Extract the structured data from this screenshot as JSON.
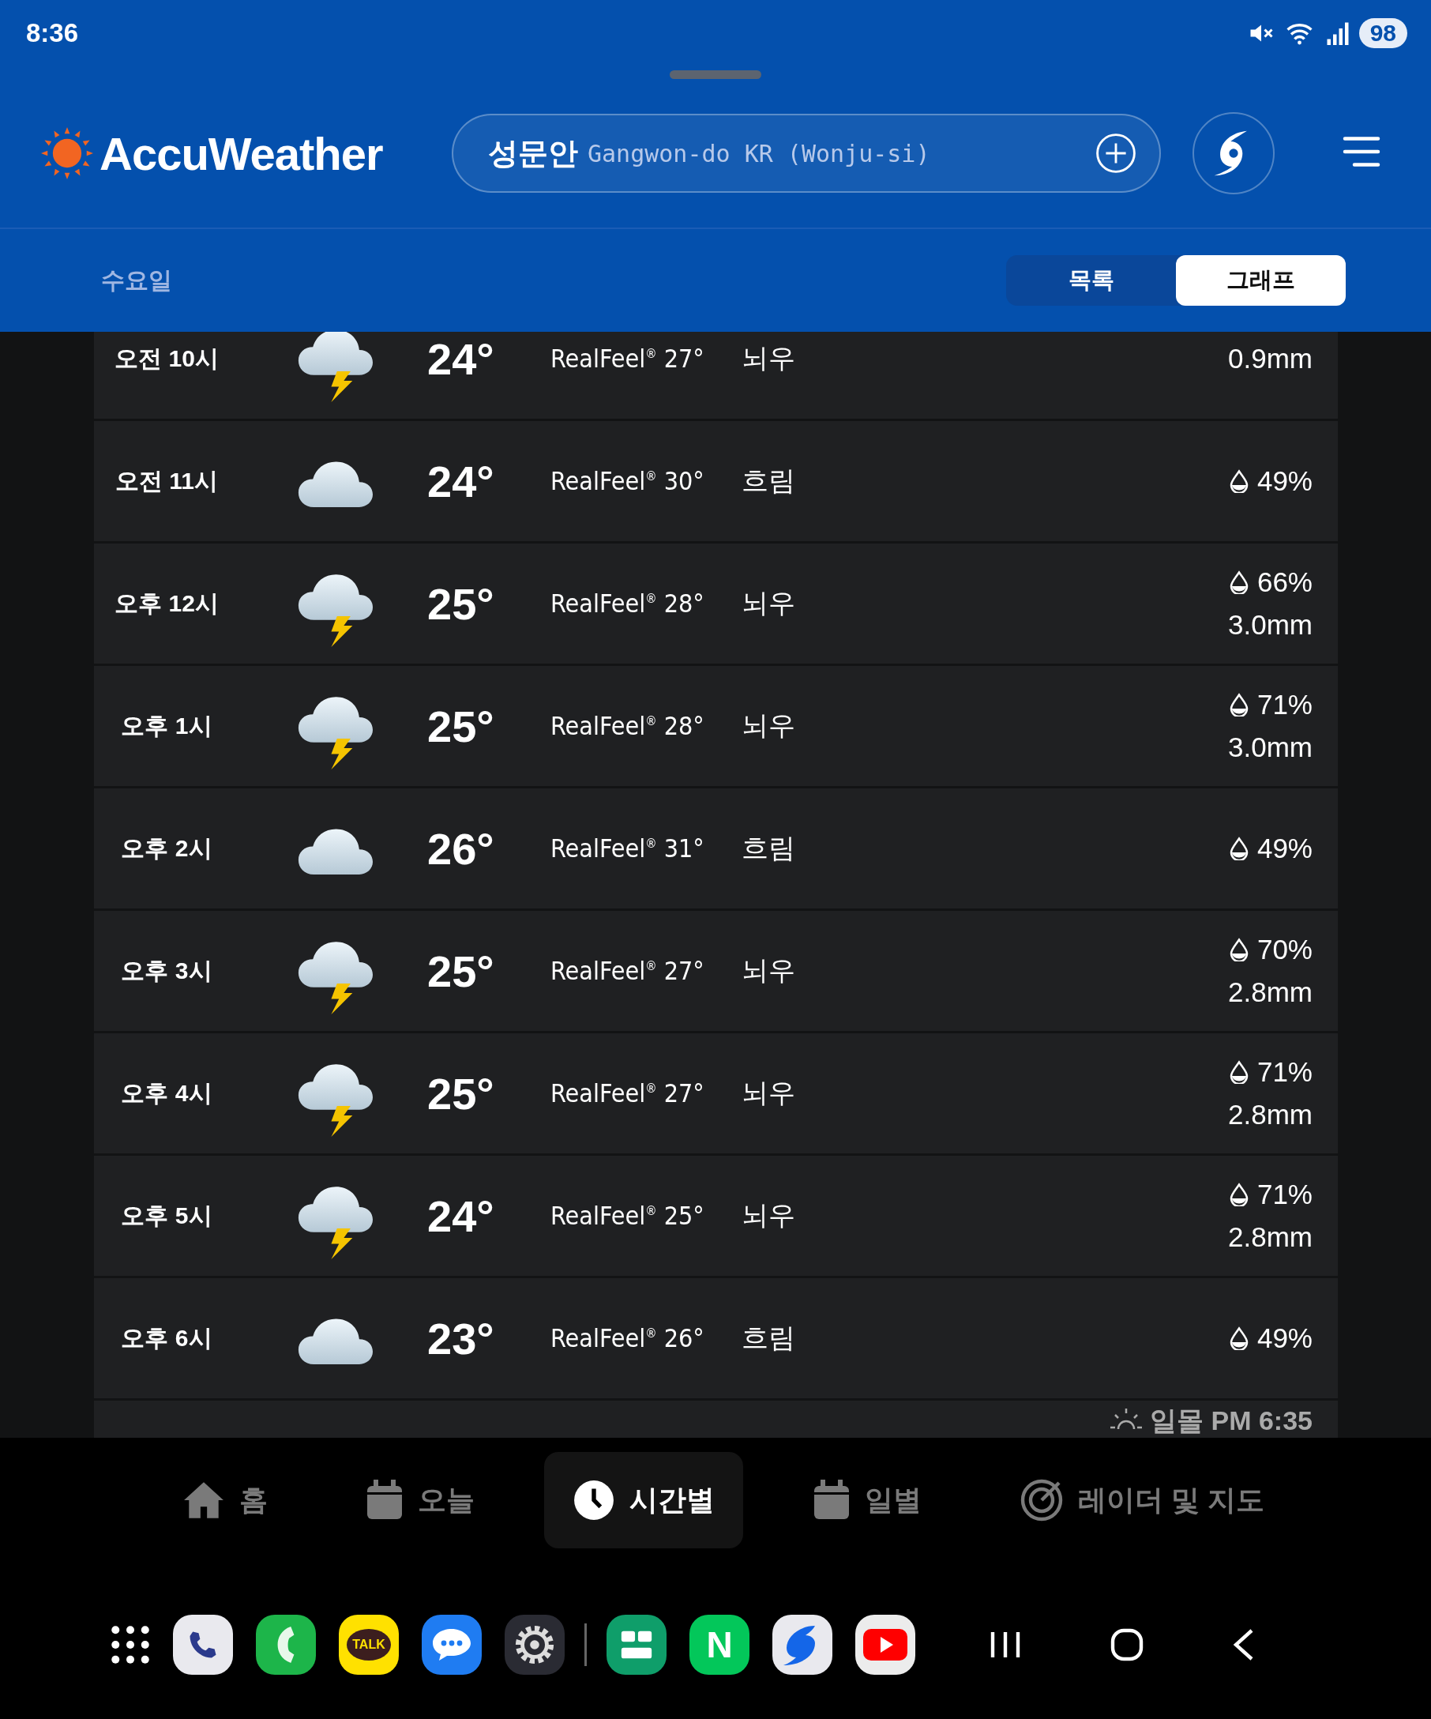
{
  "status_bar": {
    "time": "8:36",
    "battery": "98"
  },
  "header": {
    "brand": "AccuWeather",
    "location": {
      "name": "성문안",
      "detail": "Gangwon-do KR (Wonju-si)"
    }
  },
  "subheader": {
    "day": "수요일",
    "views": [
      {
        "label": "목록",
        "selected": false
      },
      {
        "label": "그래프",
        "selected": true
      }
    ]
  },
  "hours": [
    {
      "time": "오전 10시",
      "kind": "thunder",
      "temp": "24°",
      "realfeel": "RealFeel$^{®}$ 27°",
      "condition": "뇌우",
      "amount": "0.9mm"
    },
    {
      "time": "오전 11시",
      "kind": "cloudy",
      "temp": "24°",
      "realfeel": "RealFeel$^{®}$ 30°",
      "condition": "흐림",
      "chance": "49%"
    },
    {
      "time": "오후 12시",
      "kind": "thunder",
      "temp": "25°",
      "realfeel": "RealFeel$^{®}$ 28°",
      "condition": "뇌우",
      "chance": "66%",
      "amount": "3.0mm"
    },
    {
      "time": "오후 1시",
      "kind": "thunder",
      "temp": "25°",
      "realfeel": "RealFeel$^{®}$ 28°",
      "condition": "뇌우",
      "chance": "71%",
      "amount": "3.0mm"
    },
    {
      "time": "오후 2시",
      "kind": "cloudy",
      "temp": "26°",
      "realfeel": "RealFeel$^{®}$ 31°",
      "condition": "흐림",
      "chance": "49%"
    },
    {
      "time": "오후 3시",
      "kind": "thunder",
      "temp": "25°",
      "realfeel": "RealFeel$^{®}$ 27°",
      "condition": "뇌우",
      "chance": "70%",
      "amount": "2.8mm"
    },
    {
      "time": "오후 4시",
      "kind": "thunder",
      "temp": "25°",
      "realfeel": "RealFeel$^{®}$ 27°",
      "condition": "뇌우",
      "chance": "71%",
      "amount": "2.8mm"
    },
    {
      "time": "오후 5시",
      "kind": "thunder",
      "temp": "24°",
      "realfeel": "RealFeel$^{®}$ 25°",
      "condition": "뇌우",
      "chance": "71%",
      "amount": "2.8mm"
    },
    {
      "time": "오후 6시",
      "kind": "cloudy",
      "temp": "23°",
      "realfeel": "RealFeel$^{®}$ 26°",
      "condition": "흐림",
      "chance": "49%"
    }
  ],
  "sunset": "일몰 PM 6:35",
  "nav": [
    {
      "kind": "home",
      "label": "홈",
      "selected": false
    },
    {
      "kind": "today",
      "label": "오늘",
      "selected": false
    },
    {
      "kind": "hourly",
      "label": "시간별",
      "selected": true
    },
    {
      "kind": "daily",
      "label": "일별",
      "selected": false
    },
    {
      "kind": "radar",
      "label": "레이더 및 지도",
      "selected": false
    }
  ],
  "dock": [
    {
      "kind": "phone"
    },
    {
      "kind": "call"
    },
    {
      "kind": "talk",
      "text": "TALK"
    },
    {
      "kind": "messages"
    },
    {
      "kind": "settings"
    },
    {
      "kind": "program"
    },
    {
      "kind": "naver",
      "text": "N"
    },
    {
      "kind": "swirl"
    },
    {
      "kind": "youtube"
    }
  ]
}
